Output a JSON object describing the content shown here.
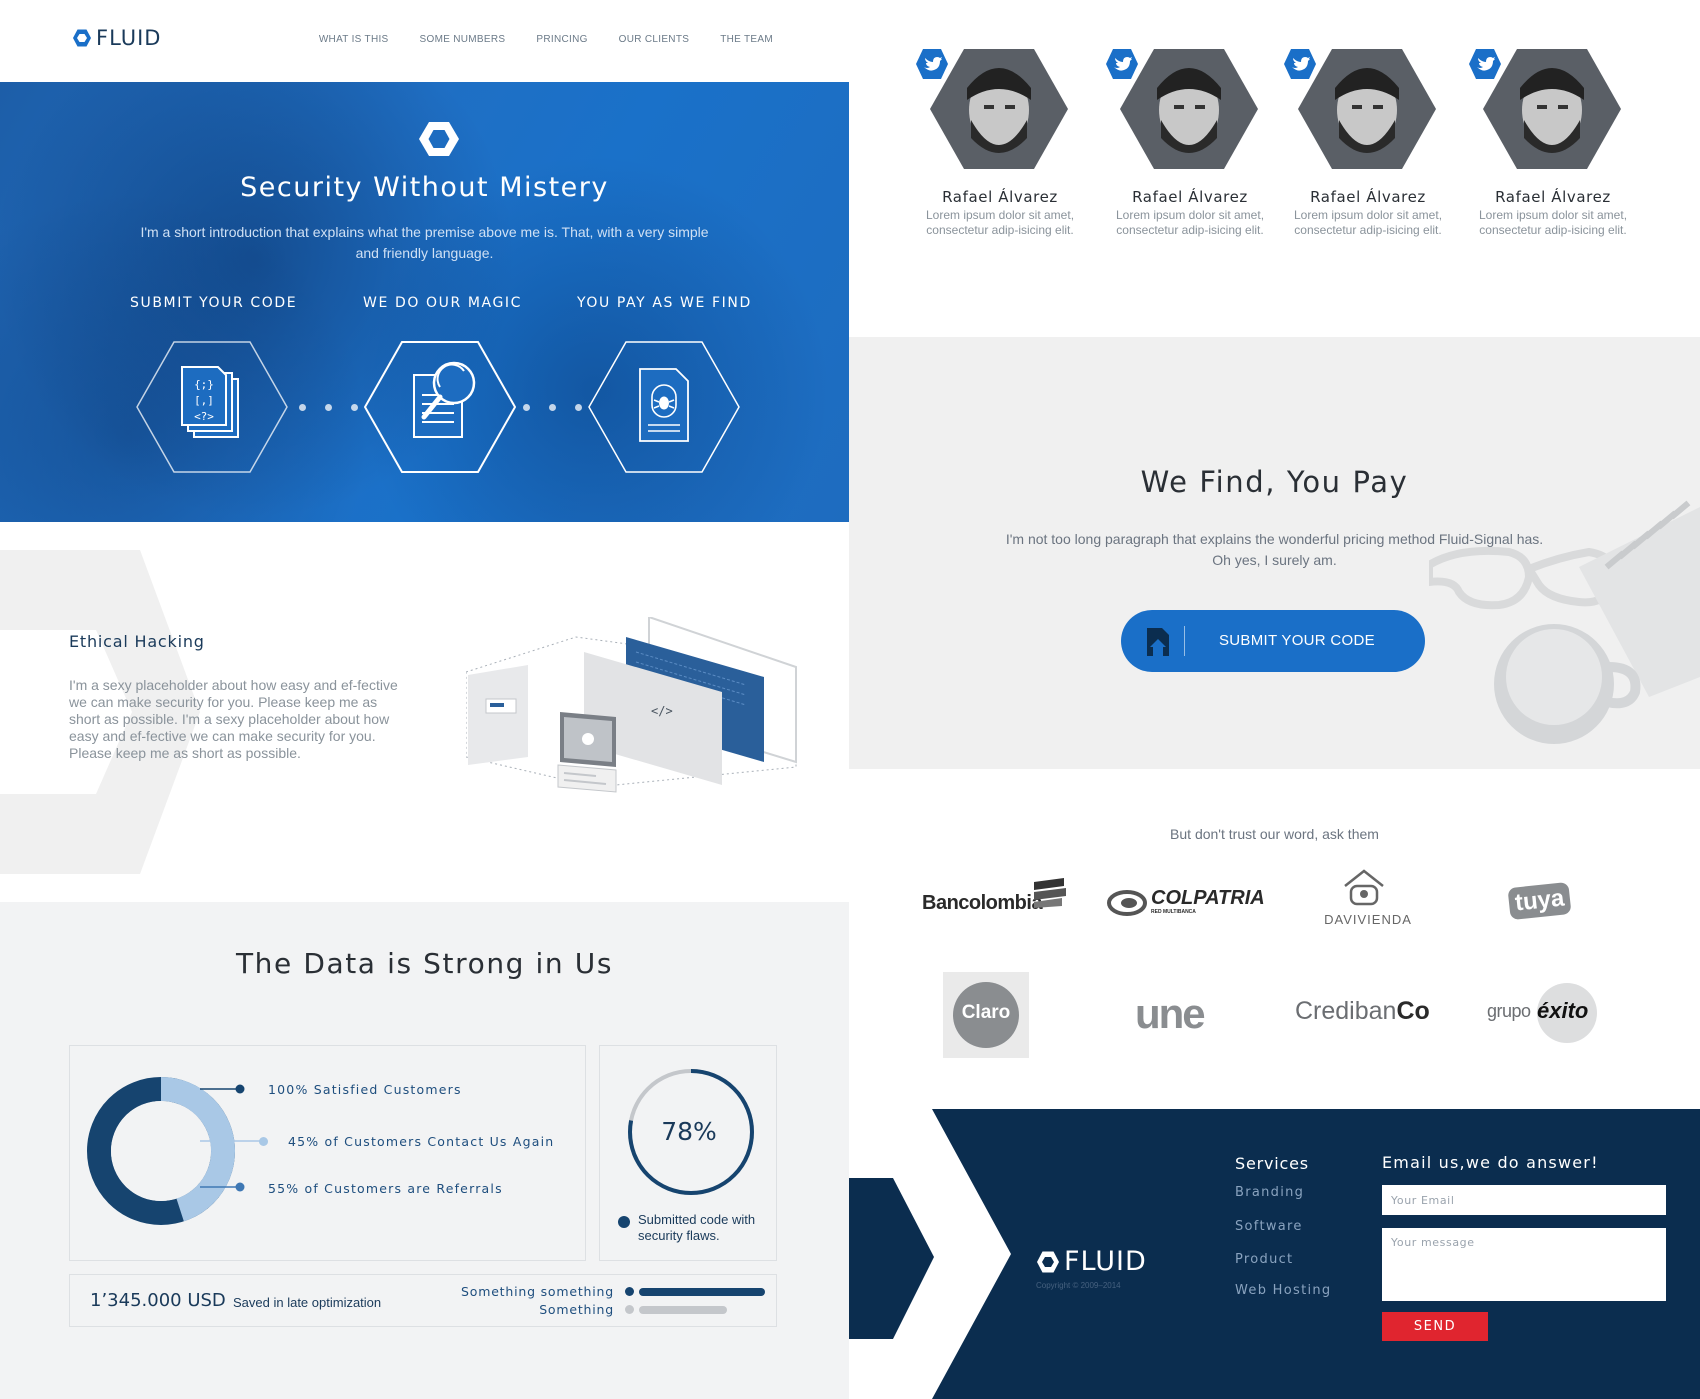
{
  "brand": {
    "name": "FLUID",
    "accent": "#1a6fc8",
    "navy": "#0b2d4f",
    "red": "#e0252f"
  },
  "nav": {
    "items": [
      {
        "label": "WHAT IS THIS"
      },
      {
        "label": "SOME NUMBERS"
      },
      {
        "label": "PRINCING"
      },
      {
        "label": "OUR CLIENTS"
      },
      {
        "label": "THE TEAM"
      }
    ]
  },
  "hero": {
    "title": "Security Without Mistery",
    "intro": "I'm a short introduction that explains what the premise above me is. That, with a very simple and friendly language.",
    "steps": [
      {
        "label": "SUBMIT YOUR CODE",
        "icon": "code-files-icon",
        "code_lines": [
          "{;}",
          "[,]",
          "<?>"
        ]
      },
      {
        "label": "WE DO OUR MAGIC",
        "icon": "magnifier-document-icon"
      },
      {
        "label": "YOU PAY AS WE FIND",
        "icon": "bug-document-icon"
      }
    ]
  },
  "ethical": {
    "title": "Ethical Hacking",
    "text": "I'm a sexy placeholder about how easy and ef-fective we can make security for you. Please keep me as short as possible. I'm a sexy placeholder about how easy and ef-fective we can make security for you. Please keep me as short as possible.",
    "illustration_code": "</>"
  },
  "data": {
    "title": "The Data is Strong in Us",
    "donut": {
      "legend": [
        {
          "label": "100% Satisfied Customers",
          "value": 100,
          "color": "#16446f"
        },
        {
          "label": "45% of Customers Contact Us Again",
          "value": 45,
          "color": "#a9c8e6"
        },
        {
          "label": "55% of Customers are Referrals",
          "value": 55,
          "color": "#3f78b4"
        }
      ]
    },
    "ring": {
      "value_text": "78%",
      "value": 78,
      "caption": "Submitted code with security flaws."
    },
    "usd": {
      "amount": "1’345.000 USD",
      "caption": "Saved in late optimization"
    },
    "bars": [
      {
        "label": "Something something",
        "value": 1.0,
        "color": "#16446f"
      },
      {
        "label": "Something",
        "value": 0.7,
        "color": "#c4c7cb"
      }
    ]
  },
  "team": {
    "members": [
      {
        "name": "Rafael Álvarez",
        "desc": "Lorem ipsum dolor sit amet, consectetur adip-isicing elit."
      },
      {
        "name": "Rafael Álvarez",
        "desc": "Lorem ipsum dolor sit amet, consectetur adip-isicing elit."
      },
      {
        "name": "Rafael Álvarez",
        "desc": "Lorem ipsum dolor sit amet, consectetur adip-isicing elit."
      },
      {
        "name": "Rafael Álvarez",
        "desc": "Lorem ipsum dolor sit amet, consectetur adip-isicing elit."
      }
    ]
  },
  "pricing": {
    "title": "We Find, You Pay",
    "text": "I'm not too long paragraph that explains the wonderful pricing method Fluid-Signal has. Oh yes, I surely am.",
    "cta_label": "SUBMIT YOUR CODE"
  },
  "clients": {
    "title": "But don't trust our word, ask them",
    "logos": [
      {
        "name": "Bancolombia"
      },
      {
        "name": "COLPATRIA",
        "sub": "RED MULTIBANCA"
      },
      {
        "name": "DAVIVIENDA"
      },
      {
        "name": "tuya"
      },
      {
        "name": "Claro"
      },
      {
        "name": "une"
      },
      {
        "name": "CredibanCo",
        "part1": "Crediban",
        "part2": "Co"
      },
      {
        "name": "grupo éxito",
        "part1": "grupo",
        "part2": "éxito"
      }
    ]
  },
  "footer": {
    "logo": "FLUID",
    "copyright": "Copyright © 2009–2014",
    "services_title": "Services",
    "services": [
      {
        "label": "Branding"
      },
      {
        "label": "Software"
      },
      {
        "label": "Product"
      },
      {
        "label": "Web Hosting"
      }
    ],
    "email_title": "Email us,we do answer!",
    "email_placeholder": "Your Email",
    "message_placeholder": "Your message",
    "send_label": "SEND"
  }
}
